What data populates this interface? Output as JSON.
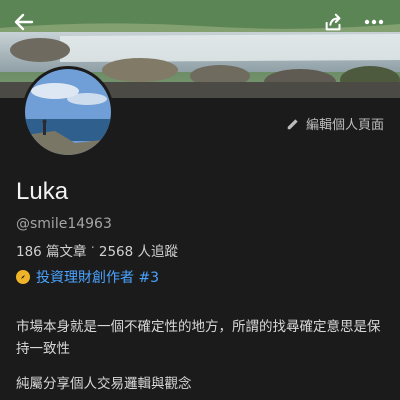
{
  "header": {
    "back_icon": "arrow-left-icon",
    "share_icon": "share-icon",
    "more_icon": "more-horizontal-icon"
  },
  "profile": {
    "name": "Luka",
    "handle": "@smile14963",
    "edit_label": "編輯個人頁面",
    "stats": {
      "articles": "186 篇文章",
      "separator": "·",
      "followers": "2568 人追蹤"
    },
    "badge": {
      "icon": "compass-icon",
      "label": "投資理財創作者 #3"
    },
    "bio_line1": "市場本身就是一個不確定性的地方，所謂的找尋確定意思是保持一致性",
    "bio_line2": "純屬分享個人交易邏輯與觀念"
  },
  "colors": {
    "background": "#1b1b1b",
    "accent_link": "#4aa3ff",
    "badge": "#f0b429"
  }
}
